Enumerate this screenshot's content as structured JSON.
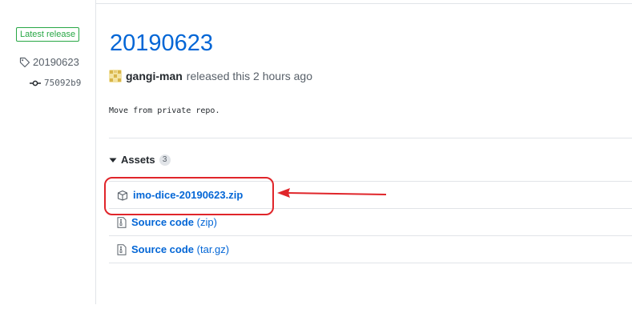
{
  "sidebar": {
    "badge": "Latest release",
    "tag": "20190623",
    "commit": "75092b9"
  },
  "release": {
    "title": "20190623",
    "author": "gangi-man",
    "byline_rest": "released this 2 hours ago",
    "body": "Move from private repo."
  },
  "assets": {
    "heading": "Assets",
    "count": "3",
    "items": [
      {
        "label": "imo-dice-20190623.zip",
        "suffix": "",
        "icon": "package-icon"
      },
      {
        "label": "Source code",
        "suffix": "(zip)",
        "icon": "file-zip-icon"
      },
      {
        "label": "Source code",
        "suffix": "(tar.gz)",
        "icon": "file-zip-icon"
      }
    ]
  },
  "colors": {
    "link": "#0366d6",
    "badge_green": "#28a745",
    "annotation_red": "#e0252a"
  }
}
